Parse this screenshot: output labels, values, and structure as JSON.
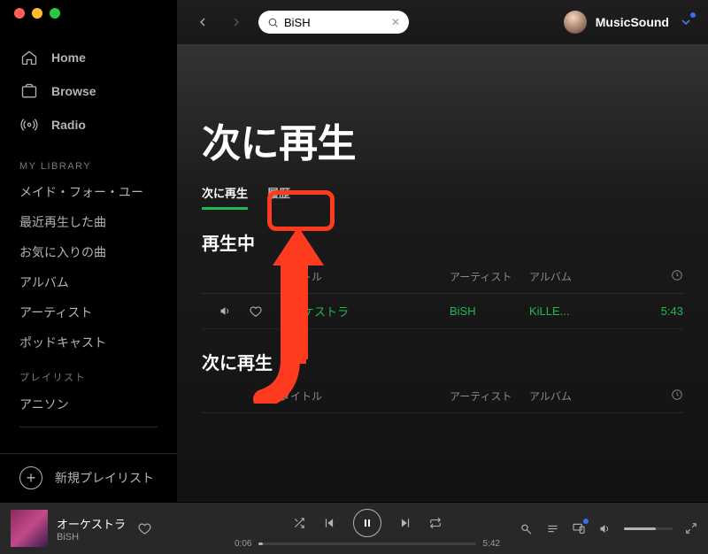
{
  "window": {
    "search_value": "BiSH",
    "username": "MusicSound"
  },
  "sidebar": {
    "nav": [
      {
        "label": "Home"
      },
      {
        "label": "Browse"
      },
      {
        "label": "Radio"
      }
    ],
    "library_label": "MY LIBRARY",
    "library": [
      "メイド・フォー・ユー",
      "最近再生した曲",
      "お気に入りの曲",
      "アルバム",
      "アーティスト",
      "ポッドキャスト"
    ],
    "playlists_label": "プレイリスト",
    "playlists": [
      "アニソン"
    ],
    "new_playlist": "新規プレイリスト"
  },
  "main": {
    "title": "次に再生",
    "tabs": [
      {
        "label": "次に再生",
        "active": true
      },
      {
        "label": "履歴",
        "active": false
      }
    ],
    "now_playing_heading": "再生中",
    "upnext_heading": "次に再生",
    "columns": {
      "title": "タイトル",
      "artist": "アーティスト",
      "album": "アルバム"
    },
    "now_playing_track": {
      "title": "オーケストラ",
      "artist": "BiSH",
      "album": "KiLLE...",
      "duration": "5:43"
    }
  },
  "player": {
    "track_title": "オーケストラ",
    "track_artist": "BiSH",
    "elapsed": "0:06",
    "total": "5:42"
  }
}
